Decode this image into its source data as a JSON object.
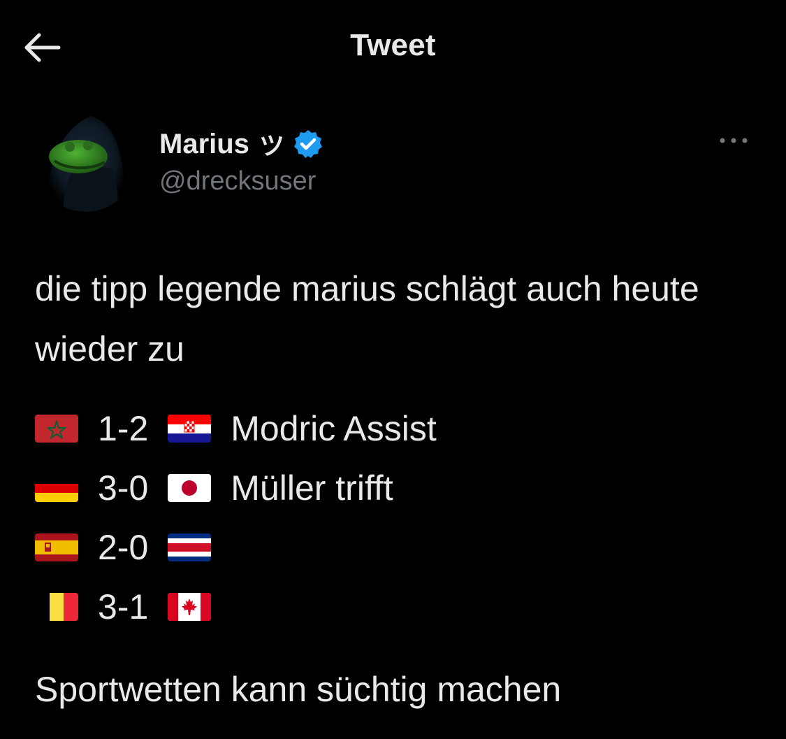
{
  "header": {
    "title": "Tweet",
    "back_icon": "arrow-left-icon"
  },
  "author": {
    "display_name": "Marius",
    "name_symbol": "ツ",
    "handle": "@drecksuser",
    "verified": true,
    "verified_color": "#1d9bf0",
    "avatar_icon": "hooded-kermit-avatar"
  },
  "tweet": {
    "intro": "die tipp legende marius schlägt auch heute wieder zu",
    "tips": [
      {
        "home_flag": "morocco-flag",
        "score": "1-2",
        "away_flag": "croatia-flag",
        "comment": "Modric Assist"
      },
      {
        "home_flag": "germany-flag",
        "score": "3-0",
        "away_flag": "japan-flag",
        "comment": "Müller trifft"
      },
      {
        "home_flag": "spain-flag",
        "score": "2-0",
        "away_flag": "costa-rica-flag",
        "comment": ""
      },
      {
        "home_flag": "belgium-flag",
        "score": "3-1",
        "away_flag": "canada-flag",
        "comment": ""
      }
    ],
    "outro": "Sportwetten kann süchtig machen"
  },
  "colors": {
    "background": "#000000",
    "text": "#e7e9ea",
    "secondary": "#71767b"
  }
}
